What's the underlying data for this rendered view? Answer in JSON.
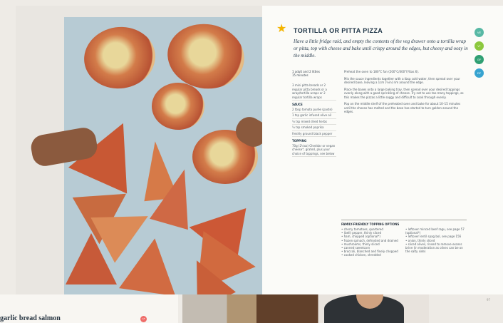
{
  "recipe": {
    "title": "TORTILLA OR PITTA PIZZA",
    "intro": "Have a little fridge raid, and empty the contents of the veg drawer onto a tortilla wrap or pitta, top with cheese and bake until crispy around the edges, but cheesy and oozy in the middle.",
    "serves": "1 adult and 2 littles",
    "time": "15 minutes",
    "badges": [
      {
        "label": "VE",
        "color": "#57b8a4"
      },
      {
        "label": "V*",
        "color": "#8cc83d"
      },
      {
        "label": "GF",
        "color": "#2f9f73"
      },
      {
        "label": "DF",
        "color": "#37a3d0"
      }
    ],
    "base": "3 mini pitta breads or 2 regular pitta breads or a wrap/tortilla wraps or 2 regular tortilla wraps",
    "sauce_heading": "SAUCE",
    "sauce": [
      "2 tbsp tomato purée (paste)",
      "1 tsp garlic infused olive oil",
      "¼ tsp mixed dried herbs",
      "¼ tsp smoked paprika",
      "freshly ground black pepper"
    ],
    "topping_heading": "TOPPING",
    "topping": "70g (2½oz) Cheddar or vegan cheese*, grated, plus your choice of toppings, see below",
    "method": [
      "Preheat the oven to 180°C fan (200°C/400°F/Gas 6).",
      "Mix the sauce ingredients together with a tbsp cold water, then spread over your desired base, leaving a 1cm (½in) rim around the edge.",
      "Place the bases onto a large baking tray, then spread over your desired toppings evenly along with a good sprinkling of cheese. Try not to use too many toppings, as this makes the pizzas a little soggy and difficult to cook through evenly.",
      "Pop on the middle shelf of the preheated oven and bake for about 10–15 minutes until the cheese has melted and the base has started to turn golden around the edges."
    ],
    "toppings_title": "FAMILY-FRIENDLY TOPPING OPTIONS",
    "toppings_left": [
      "cherry tomatoes, quartered",
      "(bell) pepper, thinly sliced",
      "ham, chopped (optional*)",
      "frozen spinach, defrosted and drained",
      "mushrooms, thinly sliced",
      "canned sweetcorn",
      "broccoli, blanched and finely chopped",
      "cooked chicken, shredded"
    ],
    "toppings_right": [
      "leftover minced beef ragu, see page 57 (optional*)",
      "leftover lentil spag bol, see page 156",
      "onion, thinly sliced",
      "sliced olives, rinsed to remove excess brine (in moderation as olives can be on the salty side)"
    ]
  },
  "page_number": "97",
  "next_page": {
    "title": "garlic bread salmon",
    "badge": "GF"
  }
}
